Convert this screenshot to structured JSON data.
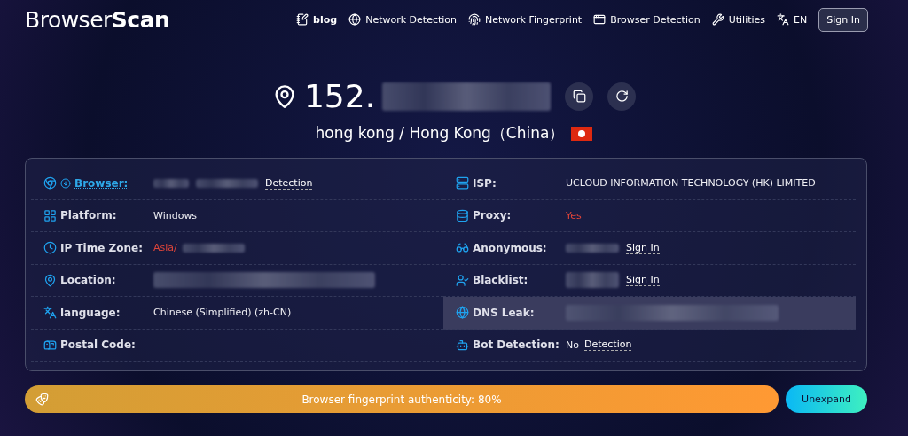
{
  "logo": "Browser**Scan**",
  "nav": [
    {
      "label": "blog",
      "bold": true
    },
    {
      "label": "Network Detection",
      "bold": false
    },
    {
      "label": "Network Fingerprint",
      "bold": false
    },
    {
      "label": "Browser Detection",
      "bold": false
    },
    {
      "label": "Utilities",
      "bold": false
    },
    {
      "label": "EN",
      "bold": false
    }
  ],
  "sign_in": "Sign In",
  "ip": {
    "prefix": "152."
  },
  "location": "hong kong / Hong Kong（China）",
  "left_rows": [
    {
      "label": "Browser:",
      "link_label": true,
      "highlighted": false,
      "parts": [
        {
          "kind": "blur"
        },
        {
          "kind": "blur"
        },
        {
          "kind": "link",
          "text": "Detection"
        }
      ]
    },
    {
      "label": "Platform:",
      "link_label": false,
      "highlighted": false,
      "parts": [
        {
          "kind": "text",
          "text": "Windows"
        }
      ]
    },
    {
      "label": "IP Time Zone:",
      "link_label": false,
      "highlighted": false,
      "parts": [
        {
          "kind": "warn",
          "text": "Asia/"
        },
        {
          "kind": "blur"
        }
      ]
    },
    {
      "label": "Location:",
      "link_label": false,
      "highlighted": false,
      "parts": [
        {
          "kind": "blur"
        }
      ]
    },
    {
      "label": "language:",
      "link_label": false,
      "highlighted": false,
      "parts": [
        {
          "kind": "text",
          "text": "Chinese (Simplified) (zh-CN)"
        }
      ]
    },
    {
      "label": "Postal Code:",
      "link_label": false,
      "highlighted": false,
      "parts": [
        {
          "kind": "text",
          "text": "-"
        }
      ]
    }
  ],
  "right_rows": [
    {
      "label": "ISP:",
      "link_label": false,
      "highlighted": false,
      "parts": [
        {
          "kind": "text",
          "text": "UCLOUD INFORMATION TECHNOLOGY (HK) LIMITED"
        }
      ]
    },
    {
      "label": "Proxy:",
      "link_label": false,
      "highlighted": false,
      "parts": [
        {
          "kind": "warn",
          "text": "Yes"
        }
      ]
    },
    {
      "label": "Anonymous:",
      "link_label": false,
      "highlighted": false,
      "parts": [
        {
          "kind": "blur"
        },
        {
          "kind": "link",
          "text": "Sign In"
        }
      ]
    },
    {
      "label": "Blacklist:",
      "link_label": false,
      "highlighted": false,
      "parts": [
        {
          "kind": "blur"
        },
        {
          "kind": "link",
          "text": "Sign In"
        }
      ]
    },
    {
      "label": "DNS Leak:",
      "link_label": false,
      "highlighted": true,
      "parts": [
        {
          "kind": "blur"
        }
      ]
    },
    {
      "label": "Bot Detection:",
      "link_label": false,
      "highlighted": false,
      "parts": [
        {
          "kind": "text",
          "text": "No"
        },
        {
          "kind": "link",
          "text": "Detection"
        }
      ]
    }
  ],
  "authenticity": "Browser fingerprint authenticity: 80%",
  "unexpand": "Unexpand"
}
